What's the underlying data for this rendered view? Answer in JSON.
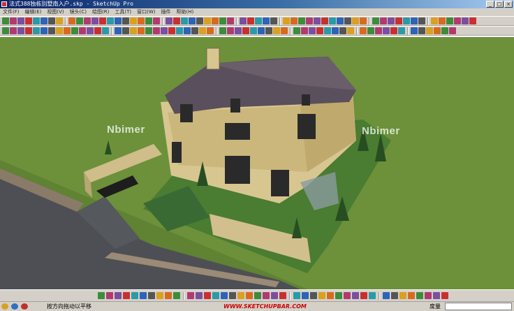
{
  "window": {
    "title": "法式388独栋别墅南入户.skp - SketchUp Pro",
    "controls": {
      "minimize": "_",
      "maximize": "□",
      "close": "×"
    }
  },
  "menu": [
    "文件(F)",
    "编辑(E)",
    "视图(V)",
    "镜头(C)",
    "绘图(R)",
    "工具(T)",
    "窗口(W)",
    "插件",
    "帮助(H)"
  ],
  "viewport": {
    "watermark": "Nbimer",
    "colors": {
      "lawn": "#6b8f3a",
      "road": "#4e4f54",
      "roof": "#5a4f5c",
      "facade": "#d8c690",
      "sky": "#ffffff"
    }
  },
  "status": {
    "hint": "按方向拖动以平移",
    "url": "WWW.SKETCHUPBAR.COM",
    "measure_label": "度量",
    "measure_value": ""
  }
}
